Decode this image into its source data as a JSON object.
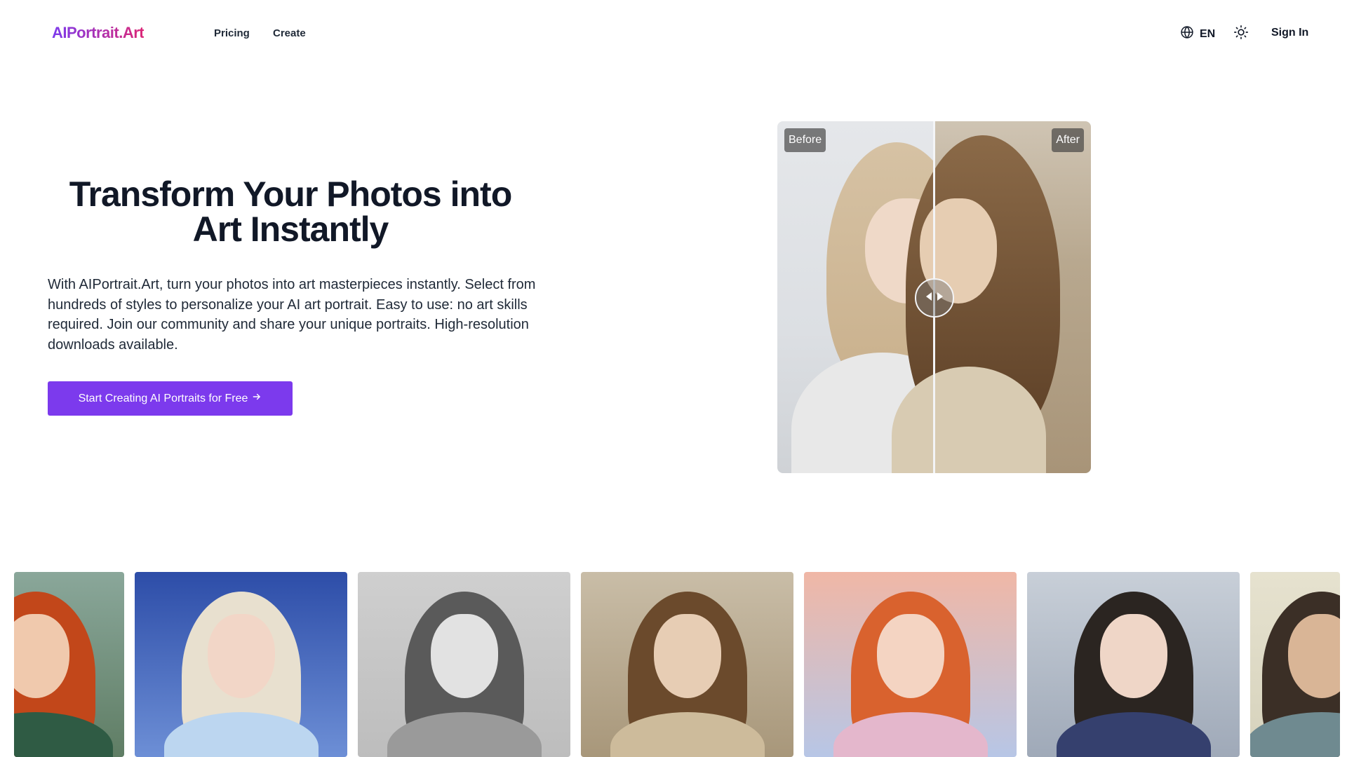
{
  "header": {
    "logo": "AIPortrait.Art",
    "nav": [
      {
        "label": "Pricing"
      },
      {
        "label": "Create"
      }
    ],
    "language": "EN",
    "language_icon": "globe-icon",
    "theme_icon": "sun-icon",
    "sign_in": "Sign In"
  },
  "hero": {
    "title": "Transform Your Photos into Art Instantly",
    "description": "With AIPortrait.Art, turn your photos into art masterpieces instantly. Select from hundreds of styles to personalize your AI art portrait. Easy to use: no art skills required. Join our community and share your unique portraits. High-resolution downloads available.",
    "cta_label": "Start Creating AI Portraits for Free",
    "cta_icon": "arrow-right-icon",
    "accent_color": "#7c3aed"
  },
  "comparison": {
    "before_label": "Before",
    "after_label": "After",
    "handle_icon": "left-right-arrows-icon"
  },
  "gallery": {
    "items": [
      {
        "style": "animated-character",
        "icon": "portrait-image"
      },
      {
        "style": "ice-princess",
        "icon": "portrait-image"
      },
      {
        "style": "pencil-sketch",
        "icon": "portrait-image"
      },
      {
        "style": "vintage-painting",
        "icon": "portrait-image"
      },
      {
        "style": "watercolor-harbor",
        "icon": "portrait-image"
      },
      {
        "style": "watercolor-cathedral",
        "icon": "portrait-image"
      },
      {
        "style": "male-portrait",
        "icon": "portrait-image"
      }
    ]
  }
}
